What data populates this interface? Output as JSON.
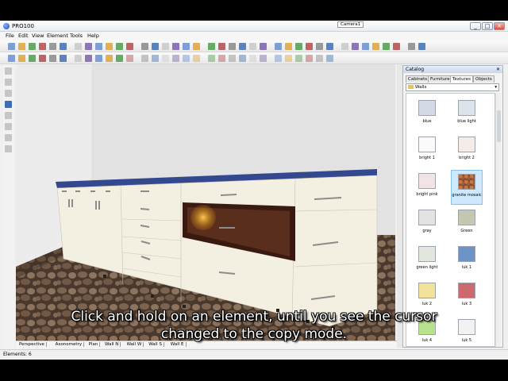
{
  "window": {
    "title": "PRO100",
    "min": "_",
    "max": "□",
    "close": "✕"
  },
  "menu": [
    "File",
    "Edit",
    "View",
    "Element",
    "Tools",
    "Help"
  ],
  "view_tabs": [
    "Perspective",
    "Axonometry",
    "Plan",
    "Wall N",
    "Wall W",
    "Wall S",
    "Wall E"
  ],
  "camera_tab": "Camera1",
  "catalog": {
    "title": "Catalog",
    "tabs": [
      "Cabinets",
      "Furniture",
      "Textures",
      "Objects"
    ],
    "active_tab": "Textures",
    "folder": "Walls",
    "swatches": [
      {
        "label": "blue",
        "color": "#d4dbe6"
      },
      {
        "label": "blue light",
        "color": "#dde3ea"
      },
      {
        "label": "bright 1",
        "color": "#fbfbfb"
      },
      {
        "label": "bright 2",
        "color": "#f3ece8"
      },
      {
        "label": "bright pink",
        "color": "#f1e3e6"
      },
      {
        "label": "granite mosaic",
        "color": "#8a4a2c"
      },
      {
        "label": "gray",
        "color": "#e3e3e3"
      },
      {
        "label": "Green",
        "color": "#c4c7b1"
      },
      {
        "label": "green light",
        "color": "#e3e8de"
      },
      {
        "label": "luk 1",
        "color": "#6e93c6"
      },
      {
        "label": "luk 2",
        "color": "#f2e29b"
      },
      {
        "label": "luk 3",
        "color": "#cc6a6f"
      },
      {
        "label": "luk 4",
        "color": "#b9e28f"
      },
      {
        "label": "luk 5",
        "color": "#f2f2f2"
      }
    ],
    "selected": "granite mosaic"
  },
  "status": "Elements: 6",
  "subtitle": [
    "Click and hold on an element, until you see the cursor",
    "changed to the copy mode."
  ],
  "colors": {
    "countertop": "#34488f",
    "cabinet": "#f3f0e1",
    "floor": "#5a4536",
    "wall": "#e4e4e4",
    "accent_blue": "#1d4fb8"
  }
}
